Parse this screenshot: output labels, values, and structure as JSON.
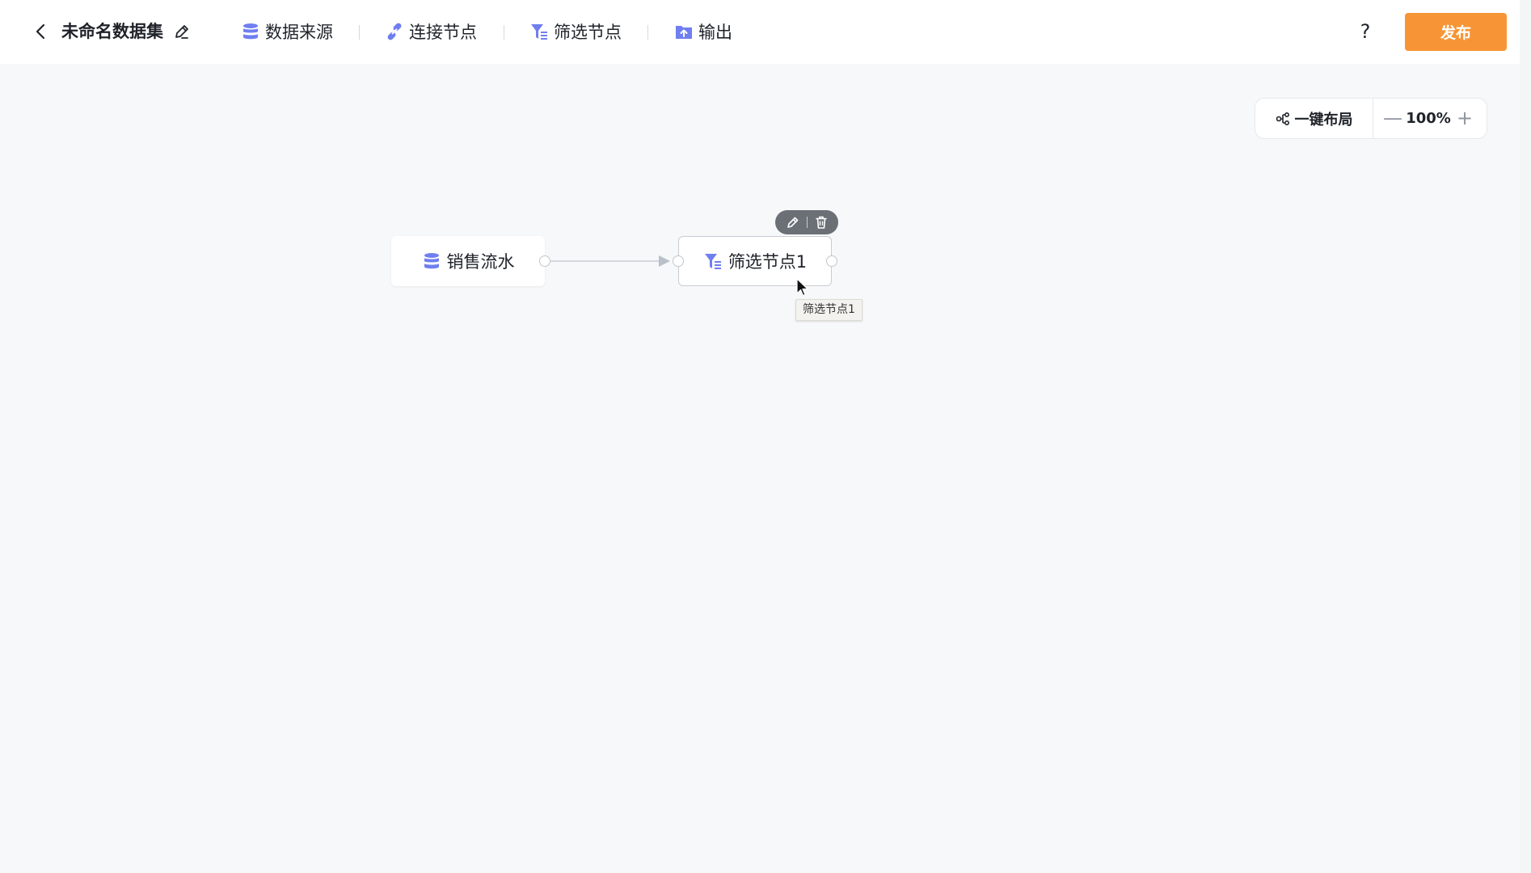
{
  "header": {
    "title": "未命名数据集",
    "tools": [
      {
        "label": "数据来源",
        "icon": "database-icon"
      },
      {
        "label": "连接节点",
        "icon": "link-icon"
      },
      {
        "label": "筛选节点",
        "icon": "filter-icon"
      },
      {
        "label": "输出",
        "icon": "folder-upload-icon"
      }
    ],
    "help_label": "?",
    "publish_label": "发布"
  },
  "zoom": {
    "auto_layout_label": "一键布局",
    "minus_label": "—",
    "value": "100%",
    "plus_label": "+"
  },
  "nodes": [
    {
      "label": "销售流水",
      "type": "datasource",
      "icon": "database-icon"
    },
    {
      "label": "筛选节点1",
      "type": "filter",
      "icon": "filter-icon",
      "selected": true
    }
  ],
  "tooltip": {
    "text": "筛选节点1"
  },
  "colors": {
    "accent": "#6f7ff0",
    "publish": "#f79536",
    "canvas": "#f7f8fa"
  }
}
